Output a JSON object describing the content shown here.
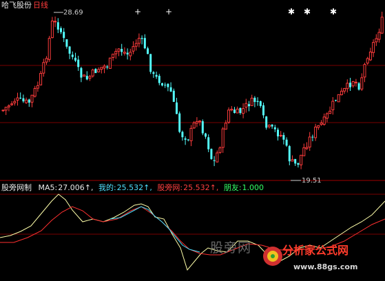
{
  "header": {
    "stock_name": "哈飞股份",
    "period": "日线"
  },
  "price_panel": {
    "high_label": "28.69",
    "low_label": "19.51",
    "star_marker": "✱",
    "cross_marker": "+"
  },
  "indicator_bar": {
    "name": "股旁网制",
    "items": [
      {
        "label": "MA5:",
        "value": "27.006↑",
        "color": "#e8e8e8"
      },
      {
        "label": "我的:",
        "value": "25.532↑",
        "color": "#4fe0ff"
      },
      {
        "label": "股旁网:",
        "value": "25.532↑",
        "color": "#ff4040"
      },
      {
        "label": "朋友:",
        "value": "1.000",
        "color": "#33ff66"
      }
    ]
  },
  "watermark": {
    "text": "股旁网",
    "brand": "分析家公式网",
    "url": "www.88gs.com"
  },
  "colors": {
    "up_candle": "#ff3c3c",
    "down_candle": "#54ffff",
    "grid": "#8b0000",
    "line_white": "#ffffaa",
    "line_red": "#ff3030",
    "line_cyan": "#40e0ff"
  }
}
